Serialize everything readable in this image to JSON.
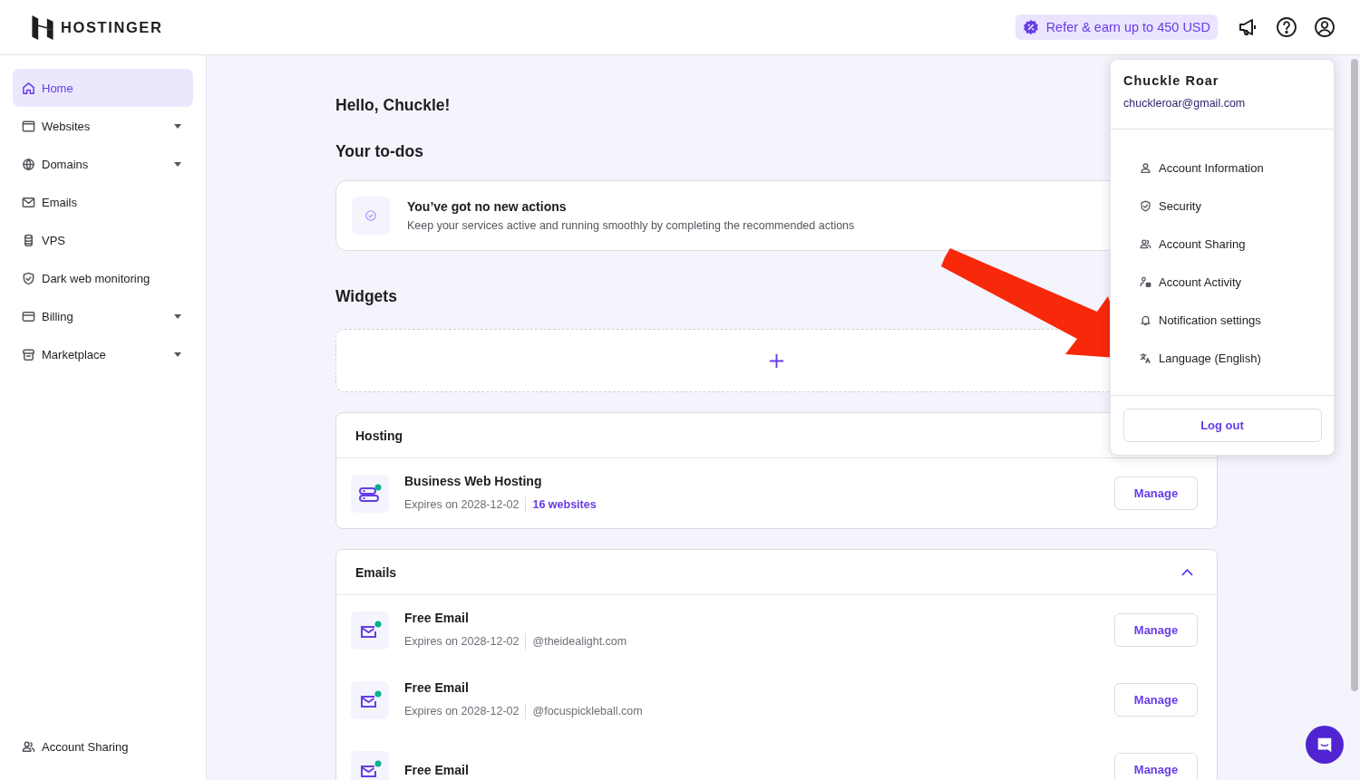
{
  "header": {
    "logo": "HOSTINGER",
    "referral": "Refer & earn up to 450 USD"
  },
  "sidebar": {
    "items": [
      {
        "label": "Home",
        "selected": true,
        "expandable": false
      },
      {
        "label": "Websites",
        "selected": false,
        "expandable": true
      },
      {
        "label": "Domains",
        "selected": false,
        "expandable": true
      },
      {
        "label": "Emails",
        "selected": false,
        "expandable": false
      },
      {
        "label": "VPS",
        "selected": false,
        "expandable": false
      },
      {
        "label": "Dark web monitoring",
        "selected": false,
        "expandable": false
      },
      {
        "label": "Billing",
        "selected": false,
        "expandable": true
      },
      {
        "label": "Marketplace",
        "selected": false,
        "expandable": true
      }
    ],
    "footer_item": {
      "label": "Account Sharing"
    }
  },
  "main": {
    "greeting": "Hello, Chuckle!",
    "todos": {
      "title": "Your to-dos",
      "empty_title": "You’ve got no new actions",
      "empty_text": "Keep your services active and running smoothly by completing the recommended actions"
    },
    "widgets": {
      "title": "Widgets"
    },
    "sections": [
      {
        "title": "Hosting",
        "items": [
          {
            "kind": "hosting",
            "name": "Business Web Hosting",
            "expires": "Expires on 2028-12-02",
            "detail": "16 websites",
            "button": "Manage"
          }
        ]
      },
      {
        "title": "Emails",
        "expanded": true,
        "items": [
          {
            "kind": "email",
            "name": "Free Email",
            "expires": "Expires on 2028-12-02",
            "detail": "@theidealight.com",
            "button": "Manage"
          },
          {
            "kind": "email",
            "name": "Free Email",
            "expires": "Expires on 2028-12-02",
            "detail": "@focuspickleball.com",
            "button": "Manage"
          },
          {
            "kind": "email",
            "name": "Free Email",
            "button": "Manage"
          }
        ]
      }
    ]
  },
  "account_menu": {
    "name": "Chuckle Roar",
    "email": "chuckleroar@gmail.com",
    "items": [
      {
        "label": "Account Information"
      },
      {
        "label": "Security"
      },
      {
        "label": "Account Sharing"
      },
      {
        "label": "Account Activity"
      },
      {
        "label": "Notification settings"
      },
      {
        "label": "Language (English)"
      }
    ],
    "logout": "Log out"
  }
}
